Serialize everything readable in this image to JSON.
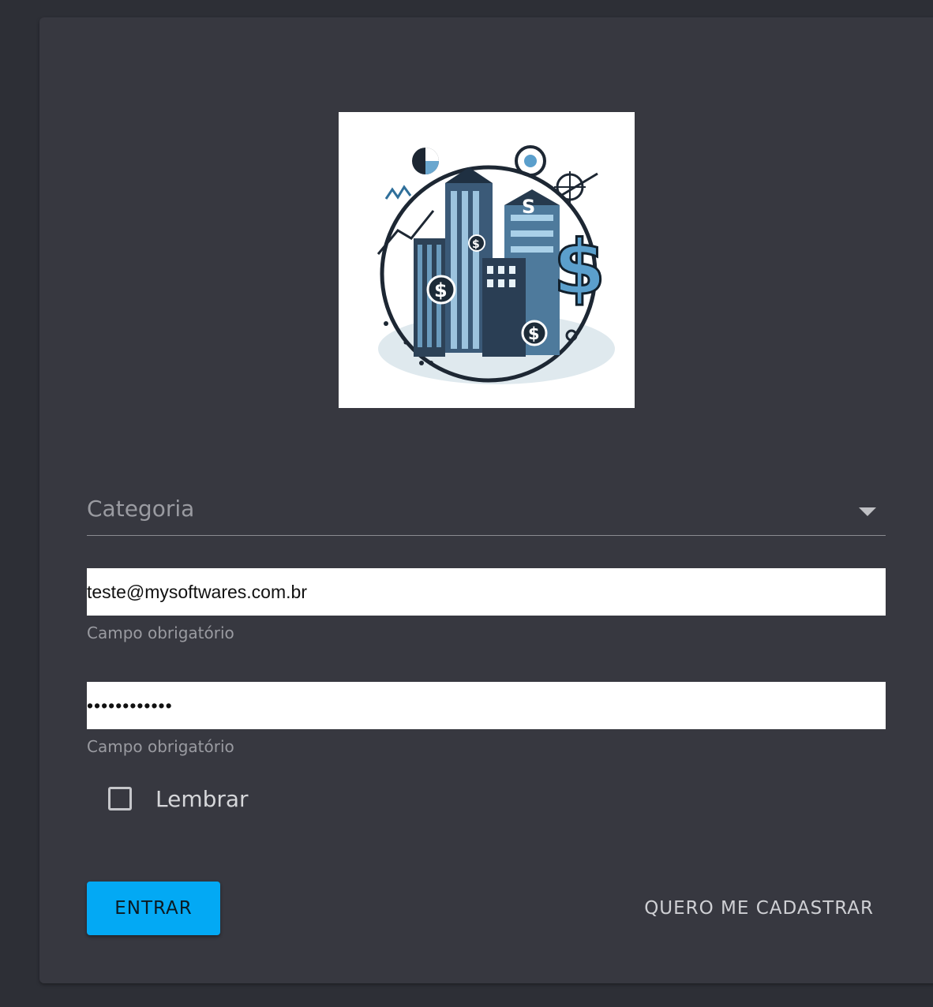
{
  "logo": {
    "icon": "finance-city-logo",
    "labels": [
      "$",
      "$",
      "$",
      "$",
      "S"
    ]
  },
  "form": {
    "category": {
      "label": "Categoria"
    },
    "email": {
      "value": "teste@mysoftwares.com.br",
      "helper": "Campo obrigatório"
    },
    "password": {
      "value": "••••••••••••",
      "helper": "Campo obrigatório"
    },
    "remember": {
      "label": "Lembrar",
      "checked": false
    },
    "submit_label": "ENTRAR",
    "register_label": "QUERO ME CADASTRAR"
  },
  "colors": {
    "background": "#2d2f36",
    "card": "#373840",
    "primary": "#03a9f4"
  }
}
